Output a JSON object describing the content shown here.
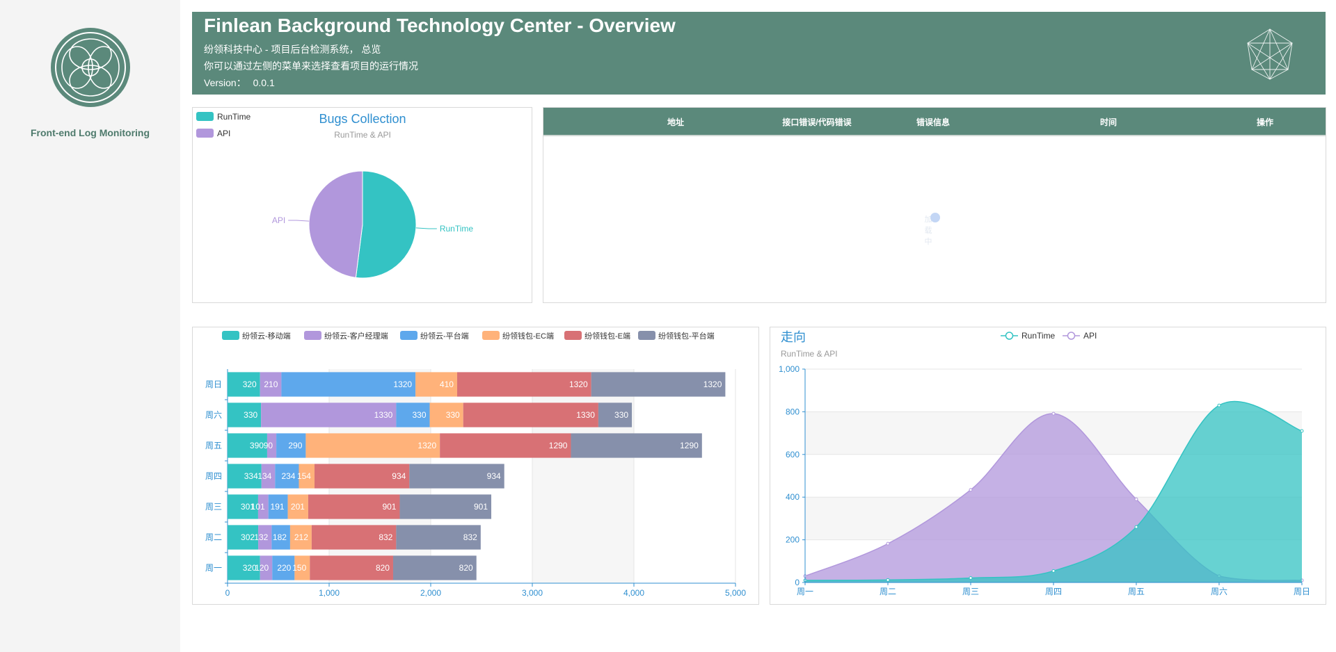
{
  "sidebar": {
    "title": "Front-end Log Monitoring"
  },
  "header": {
    "title": "Finlean Background Technology Center - Overview",
    "line1": "纷领科技中心 - 项目后台检测系统， 总览",
    "line2": "你可以通过左侧的菜单来选择查看项目的运行情况",
    "version_label": "Version：",
    "version": "0.0.1"
  },
  "table": {
    "columns": [
      "地址",
      "接口错误/代码错误",
      "错误信息",
      "时间",
      "操作"
    ],
    "rows": [],
    "loading_text": "加载中"
  },
  "colors": {
    "brand": "#5b897b",
    "teal": "#34c3c3",
    "purple": "#b197dc",
    "blue": "#5ea8ec",
    "orange": "#ffb27a",
    "red": "#d87175",
    "slate": "#8690ab",
    "axis": "#2f8fd0"
  },
  "chart_data": [
    {
      "type": "pie",
      "title": "Bugs Collection",
      "subtitle": "RunTime & API",
      "legend": [
        "RunTime",
        "API"
      ],
      "legend_position": "top-left",
      "slices": [
        {
          "name": "RunTime",
          "value": 52
        },
        {
          "name": "API",
          "value": 48
        }
      ]
    },
    {
      "type": "bar",
      "orientation": "horizontal",
      "stacked": true,
      "categories": [
        "周一",
        "周二",
        "周三",
        "周四",
        "周五",
        "周六",
        "周日"
      ],
      "series": [
        {
          "name": "纷领云-移动端",
          "values": [
            320,
            302,
            301,
            334,
            390,
            330,
            320
          ]
        },
        {
          "name": "纷领云-客户经理端",
          "values": [
            120,
            132,
            101,
            134,
            90,
            1330,
            210
          ]
        },
        {
          "name": "纷领云-平台端",
          "values": [
            220,
            182,
            191,
            234,
            290,
            330,
            1320
          ]
        },
        {
          "name": "纷领钱包-EC端",
          "values": [
            150,
            212,
            201,
            154,
            1320,
            330,
            410
          ]
        },
        {
          "name": "纷领钱包-E端",
          "values": [
            820,
            832,
            901,
            934,
            1290,
            1330,
            1320
          ]
        },
        {
          "name": "纷领钱包-平台端",
          "values": [
            820,
            832,
            901,
            934,
            1290,
            330,
            1320
          ]
        }
      ],
      "xlim": [
        0,
        5000
      ],
      "x_ticks": [
        "0",
        "1,000",
        "2,000",
        "3,000",
        "4,000",
        "5,000"
      ],
      "legend_position": "top",
      "grid": true
    },
    {
      "type": "area",
      "title": "走向",
      "subtitle": "RunTime & API",
      "categories": [
        "周一",
        "周二",
        "周三",
        "周四",
        "周五",
        "周六",
        "周日"
      ],
      "series": [
        {
          "name": "RunTime",
          "values": [
            10,
            12,
            21,
            54,
            260,
            830,
            710
          ]
        },
        {
          "name": "API",
          "values": [
            30,
            182,
            434,
            791,
            390,
            30,
            10
          ]
        }
      ],
      "ylim": [
        0,
        1000
      ],
      "y_ticks": [
        "0",
        "200",
        "400",
        "600",
        "800",
        "1,000"
      ],
      "legend_position": "top",
      "grid": true
    }
  ]
}
